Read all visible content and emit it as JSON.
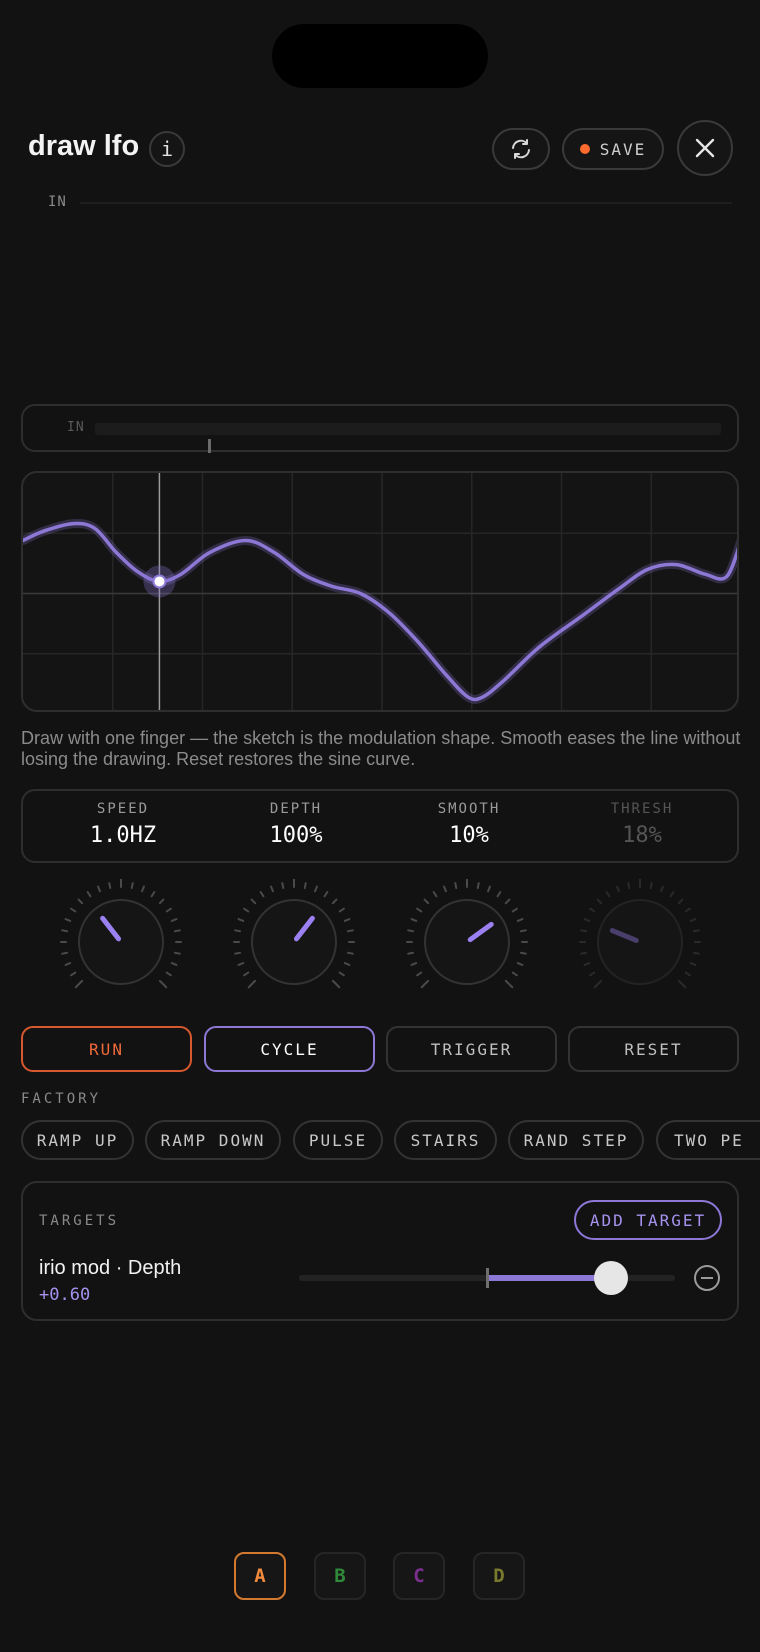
{
  "header": {
    "title": "draw lfo",
    "info_glyph": "i",
    "save_label": "SAVE",
    "accent_color": "#ff6a2e"
  },
  "input_meter": {
    "top_label": "IN",
    "box_label": "IN",
    "level": 0.18
  },
  "canvas": {
    "playhead_phase": 0.19,
    "grid": true,
    "shape_color": "#8d78d6",
    "shape_points": [
      [
        0.0,
        0.28
      ],
      [
        0.03,
        0.24
      ],
      [
        0.07,
        0.21
      ],
      [
        0.1,
        0.23
      ],
      [
        0.13,
        0.33
      ],
      [
        0.16,
        0.41
      ],
      [
        0.19,
        0.45
      ],
      [
        0.22,
        0.42
      ],
      [
        0.26,
        0.33
      ],
      [
        0.31,
        0.28
      ],
      [
        0.35,
        0.33
      ],
      [
        0.39,
        0.42
      ],
      [
        0.43,
        0.47
      ],
      [
        0.47,
        0.5
      ],
      [
        0.51,
        0.58
      ],
      [
        0.55,
        0.7
      ],
      [
        0.59,
        0.84
      ],
      [
        0.62,
        0.93
      ],
      [
        0.64,
        0.93
      ],
      [
        0.67,
        0.86
      ],
      [
        0.72,
        0.72
      ],
      [
        0.78,
        0.59
      ],
      [
        0.83,
        0.48
      ],
      [
        0.87,
        0.4
      ],
      [
        0.91,
        0.38
      ],
      [
        0.95,
        0.42
      ],
      [
        0.98,
        0.43
      ],
      [
        1.0,
        0.28
      ]
    ]
  },
  "hint": "Draw with one finger — the sketch is the modulation shape. Smooth eases the line without losing the drawing. Reset restores the sine curve.",
  "params": [
    {
      "label": "SPEED",
      "value": "1.0HZ",
      "knob": 0.36,
      "enabled": true
    },
    {
      "label": "DEPTH",
      "value": "100%",
      "knob": 0.64,
      "enabled": true
    },
    {
      "label": "SMOOTH",
      "value": "10%",
      "knob": 0.7,
      "enabled": true
    },
    {
      "label": "THRESH",
      "value": "18%",
      "knob": 0.25,
      "enabled": false
    }
  ],
  "modes": [
    {
      "label": "RUN",
      "state": "run"
    },
    {
      "label": "CYCLE",
      "state": "selected"
    },
    {
      "label": "TRIGGER",
      "state": "idle"
    },
    {
      "label": "RESET",
      "state": "idle"
    }
  ],
  "factory": {
    "label": "FACTORY",
    "presets": [
      "RAMP UP",
      "RAMP DOWN",
      "PULSE",
      "STAIRS",
      "RAND STEP",
      "TWO PE"
    ]
  },
  "targets": {
    "label": "TARGETS",
    "add_label": "ADD TARGET",
    "items": [
      {
        "name": "irio mod · Depth",
        "value": "+0.60",
        "amount": 0.6
      }
    ]
  },
  "banks": [
    {
      "label": "A",
      "color": "#f28a3c",
      "active": true
    },
    {
      "label": "B",
      "color": "#2f8a3a",
      "active": false
    },
    {
      "label": "C",
      "color": "#7a2f8f",
      "active": false
    },
    {
      "label": "D",
      "color": "#7a7a2e",
      "active": false
    }
  ]
}
